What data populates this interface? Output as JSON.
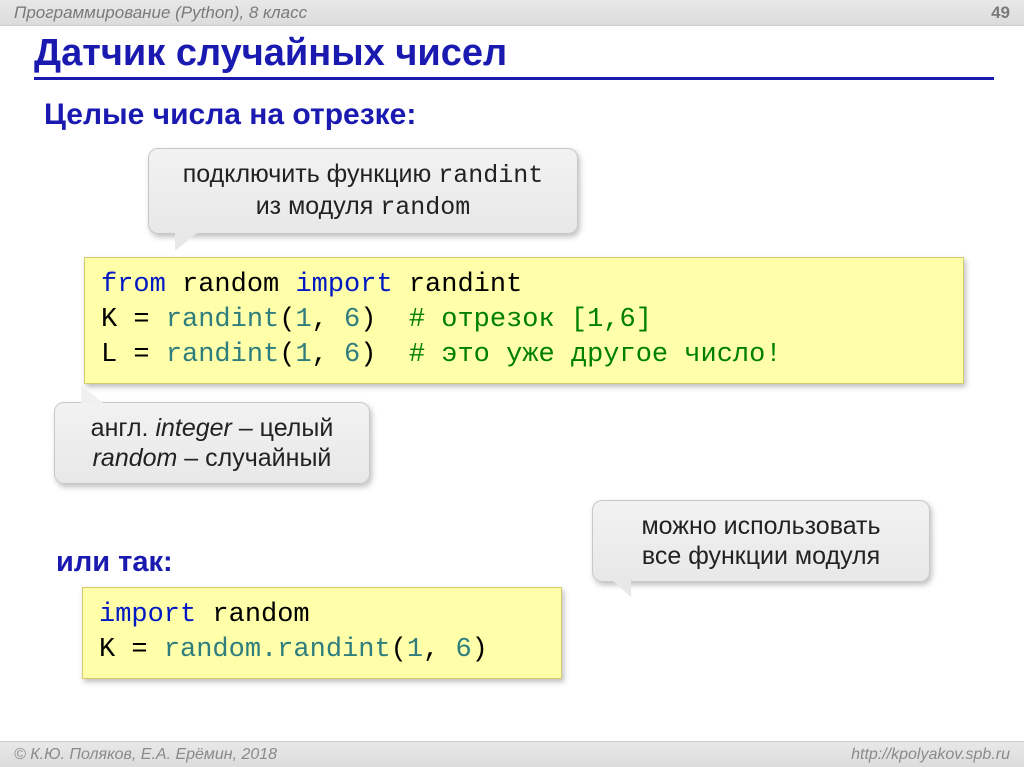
{
  "header": {
    "course": "Программирование (Python), 8 класс",
    "page": "49"
  },
  "title": "Датчик случайных чисел",
  "subtitle": "Целые числа на отрезке:",
  "callout1_line1": "подключить функцию ",
  "callout1_mono1": "randint",
  "callout1_line2": "из модуля ",
  "callout1_mono2": "random",
  "code1": {
    "l1a": "from",
    "l1b": " random ",
    "l1c": "import",
    "l1d": " randint",
    "l2a": "K = ",
    "l2b": "randint",
    "l2c": "(",
    "l2d": "1",
    "l2e": ", ",
    "l2f": "6",
    "l2g": ")  ",
    "l2h": "# отрезок [1,6]",
    "l3a": "L = ",
    "l3b": "randint",
    "l3c": "(",
    "l3d": "1",
    "l3e": ", ",
    "l3f": "6",
    "l3g": ")  ",
    "l3h": "# это уже другое число!"
  },
  "callout2_a": "англ. ",
  "callout2_b": "integer",
  "callout2_c": " – целый",
  "callout2_d": "random",
  "callout2_e": " – случайный",
  "or_so": "или так:",
  "code2": {
    "l1a": "import",
    "l1b": " random",
    "l2a": "K = ",
    "l2b": "random.randint",
    "l2c": "(",
    "l2d": "1",
    "l2e": ", ",
    "l2f": "6",
    "l2g": ")"
  },
  "callout3_line1": "можно использовать",
  "callout3_line2": "все функции модуля",
  "footer": {
    "copyright": "© К.Ю. Поляков, Е.А. Ерёмин, 2018",
    "url": "http://kpolyakov.spb.ru"
  }
}
